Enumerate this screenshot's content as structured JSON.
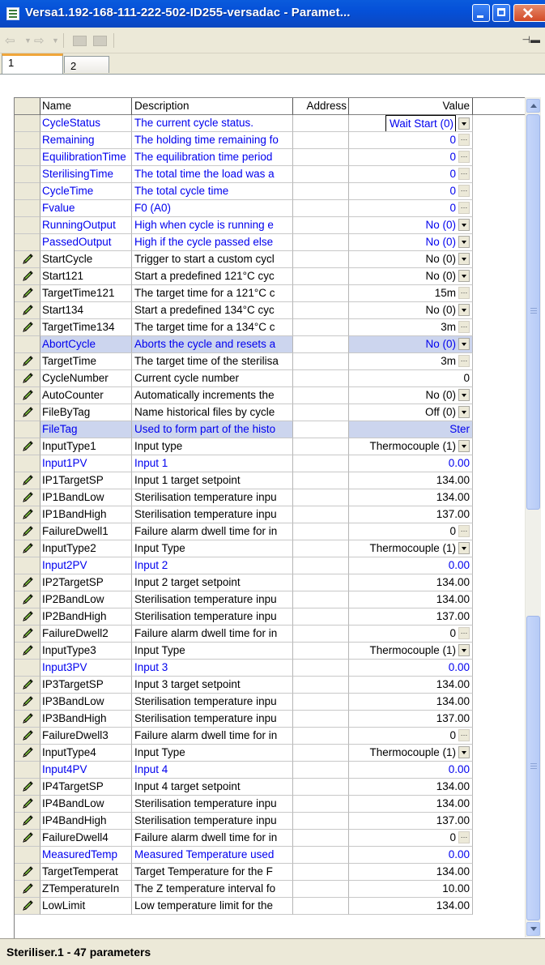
{
  "window": {
    "title": "Versa1.192-168-111-222-502-ID255-versadac - Paramet...",
    "tabs": [
      "1",
      "2"
    ],
    "status": "Steriliser.1  -  47 parameters"
  },
  "table": {
    "headers": {
      "name": "Name",
      "description": "Description",
      "address": "Address",
      "value": "Value"
    },
    "rows": [
      {
        "name": "CycleStatus",
        "desc": "The current cycle status.",
        "value": "Wait Start (0)",
        "kind": "dd",
        "edit": false,
        "blue": true,
        "hl": false,
        "focus": true
      },
      {
        "name": "Remaining",
        "desc": "The holding time remaining fo",
        "value": "0",
        "kind": "el",
        "edit": false,
        "blue": true,
        "hl": false
      },
      {
        "name": "EquilibrationTime",
        "desc": "The equilibration time period",
        "value": "0",
        "kind": "el",
        "edit": false,
        "blue": true,
        "hl": false
      },
      {
        "name": "SterilisingTime",
        "desc": "The total time the load was a",
        "value": "0",
        "kind": "el",
        "edit": false,
        "blue": true,
        "hl": false
      },
      {
        "name": "CycleTime",
        "desc": "The total cycle time",
        "value": "0",
        "kind": "el",
        "edit": false,
        "blue": true,
        "hl": false
      },
      {
        "name": "Fvalue",
        "desc": "F0 (A0)",
        "value": "0",
        "kind": "el",
        "edit": false,
        "blue": true,
        "hl": false
      },
      {
        "name": "RunningOutput",
        "desc": "High when cycle is running e",
        "value": "No (0)",
        "kind": "dd",
        "edit": false,
        "blue": true,
        "hl": false
      },
      {
        "name": "PassedOutput",
        "desc": "High if the cycle passed else",
        "value": "No (0)",
        "kind": "dd",
        "edit": false,
        "blue": true,
        "hl": false
      },
      {
        "name": "StartCycle",
        "desc": "Trigger to start a custom cycl",
        "value": "No (0)",
        "kind": "dd",
        "edit": true,
        "blue": false,
        "hl": false
      },
      {
        "name": "Start121",
        "desc": "Start a predefined 121°C cyc",
        "value": "No (0)",
        "kind": "dd",
        "edit": true,
        "blue": false,
        "hl": false
      },
      {
        "name": "TargetTime121",
        "desc": "The target time for a 121°C c",
        "value": "15m",
        "kind": "el",
        "edit": true,
        "blue": false,
        "hl": false
      },
      {
        "name": "Start134",
        "desc": "Start a predefined 134°C cyc",
        "value": "No (0)",
        "kind": "dd",
        "edit": true,
        "blue": false,
        "hl": false
      },
      {
        "name": "TargetTime134",
        "desc": "The target time for a 134°C c",
        "value": "3m",
        "kind": "el",
        "edit": true,
        "blue": false,
        "hl": false
      },
      {
        "name": "AbortCycle",
        "desc": "Aborts the cycle and resets a",
        "value": "No (0)",
        "kind": "dd",
        "edit": false,
        "blue": true,
        "hl": true
      },
      {
        "name": "TargetTime",
        "desc": "The target time of the sterilisa",
        "value": "3m",
        "kind": "el",
        "edit": true,
        "blue": false,
        "hl": false
      },
      {
        "name": "CycleNumber",
        "desc": "Current cycle number",
        "value": "0",
        "kind": "plain",
        "edit": true,
        "blue": false,
        "hl": false
      },
      {
        "name": "AutoCounter",
        "desc": "Automatically increments the",
        "value": "No (0)",
        "kind": "dd",
        "edit": true,
        "blue": false,
        "hl": false
      },
      {
        "name": "FileByTag",
        "desc": "Name historical files by cycle",
        "value": "Off (0)",
        "kind": "dd",
        "edit": true,
        "blue": false,
        "hl": false
      },
      {
        "name": "FileTag",
        "desc": "Used to form part of the histo",
        "value": "Ster",
        "kind": "plain",
        "edit": false,
        "blue": true,
        "hl": true
      },
      {
        "name": "InputType1",
        "desc": "Input type",
        "value": "Thermocouple (1)",
        "kind": "dd",
        "edit": true,
        "blue": false,
        "hl": false
      },
      {
        "name": "Input1PV",
        "desc": "Input 1",
        "value": "0.00",
        "kind": "plain",
        "edit": false,
        "blue": true,
        "hl": false
      },
      {
        "name": "IP1TargetSP",
        "desc": "Input 1 target setpoint",
        "value": "134.00",
        "kind": "plain",
        "edit": true,
        "blue": false,
        "hl": false
      },
      {
        "name": "IP1BandLow",
        "desc": "Sterilisation temperature inpu",
        "value": "134.00",
        "kind": "plain",
        "edit": true,
        "blue": false,
        "hl": false
      },
      {
        "name": "IP1BandHigh",
        "desc": "Sterilisation temperature inpu",
        "value": "137.00",
        "kind": "plain",
        "edit": true,
        "blue": false,
        "hl": false
      },
      {
        "name": "FailureDwell1",
        "desc": "Failure alarm dwell time for in",
        "value": "0",
        "kind": "el",
        "edit": true,
        "blue": false,
        "hl": false
      },
      {
        "name": "InputType2",
        "desc": "Input Type",
        "value": "Thermocouple (1)",
        "kind": "dd",
        "edit": true,
        "blue": false,
        "hl": false
      },
      {
        "name": "Input2PV",
        "desc": "Input 2",
        "value": "0.00",
        "kind": "plain",
        "edit": false,
        "blue": true,
        "hl": false
      },
      {
        "name": "IP2TargetSP",
        "desc": "Input 2 target setpoint",
        "value": "134.00",
        "kind": "plain",
        "edit": true,
        "blue": false,
        "hl": false
      },
      {
        "name": "IP2BandLow",
        "desc": "Sterilisation temperature inpu",
        "value": "134.00",
        "kind": "plain",
        "edit": true,
        "blue": false,
        "hl": false
      },
      {
        "name": "IP2BandHigh",
        "desc": "Sterilisation temperature inpu",
        "value": "137.00",
        "kind": "plain",
        "edit": true,
        "blue": false,
        "hl": false
      },
      {
        "name": "FailureDwell2",
        "desc": "Failure alarm dwell time for in",
        "value": "0",
        "kind": "el",
        "edit": true,
        "blue": false,
        "hl": false
      },
      {
        "name": "InputType3",
        "desc": "Input Type",
        "value": "Thermocouple (1)",
        "kind": "dd",
        "edit": true,
        "blue": false,
        "hl": false
      },
      {
        "name": "Input3PV",
        "desc": "Input 3",
        "value": "0.00",
        "kind": "plain",
        "edit": false,
        "blue": true,
        "hl": false
      },
      {
        "name": "IP3TargetSP",
        "desc": "Input 3 target setpoint",
        "value": "134.00",
        "kind": "plain",
        "edit": true,
        "blue": false,
        "hl": false
      },
      {
        "name": "IP3BandLow",
        "desc": "Sterilisation temperature inpu",
        "value": "134.00",
        "kind": "plain",
        "edit": true,
        "blue": false,
        "hl": false
      },
      {
        "name": "IP3BandHigh",
        "desc": "Sterilisation temperature inpu",
        "value": "137.00",
        "kind": "plain",
        "edit": true,
        "blue": false,
        "hl": false
      },
      {
        "name": "FailureDwell3",
        "desc": "Failure alarm dwell time for in",
        "value": "0",
        "kind": "el",
        "edit": true,
        "blue": false,
        "hl": false
      },
      {
        "name": "InputType4",
        "desc": "Input Type",
        "value": "Thermocouple (1)",
        "kind": "dd",
        "edit": true,
        "blue": false,
        "hl": false
      },
      {
        "name": "Input4PV",
        "desc": "Input 4",
        "value": "0.00",
        "kind": "plain",
        "edit": false,
        "blue": true,
        "hl": false
      },
      {
        "name": "IP4TargetSP",
        "desc": "Input 4 target setpoint",
        "value": "134.00",
        "kind": "plain",
        "edit": true,
        "blue": false,
        "hl": false
      },
      {
        "name": "IP4BandLow",
        "desc": "Sterilisation temperature inpu",
        "value": "134.00",
        "kind": "plain",
        "edit": true,
        "blue": false,
        "hl": false
      },
      {
        "name": "IP4BandHigh",
        "desc": "Sterilisation temperature inpu",
        "value": "137.00",
        "kind": "plain",
        "edit": true,
        "blue": false,
        "hl": false
      },
      {
        "name": "FailureDwell4",
        "desc": "Failure alarm dwell time for in",
        "value": "0",
        "kind": "el",
        "edit": true,
        "blue": false,
        "hl": false
      },
      {
        "name": "MeasuredTemp",
        "desc": "Measured Temperature used",
        "value": "0.00",
        "kind": "plain",
        "edit": false,
        "blue": true,
        "hl": false
      },
      {
        "name": "TargetTemperat",
        "desc": "Target Temperature for the F",
        "value": "134.00",
        "kind": "plain",
        "edit": true,
        "blue": false,
        "hl": false
      },
      {
        "name": "ZTemperatureIn",
        "desc": "The Z temperature interval fo",
        "value": "10.00",
        "kind": "plain",
        "edit": true,
        "blue": false,
        "hl": false
      },
      {
        "name": "LowLimit",
        "desc": "Low temperature limit for the",
        "value": "134.00",
        "kind": "plain",
        "edit": true,
        "blue": false,
        "hl": false
      }
    ]
  },
  "icons": {
    "pencil": "pencil-icon",
    "ellipsis": "…",
    "dropdown": "chevron-down-icon"
  },
  "colors": {
    "title_bar": "#0550d8",
    "link_text": "#0000ee",
    "highlight_row": "#ccd5ee",
    "tab_accent": "#f0a63a"
  }
}
